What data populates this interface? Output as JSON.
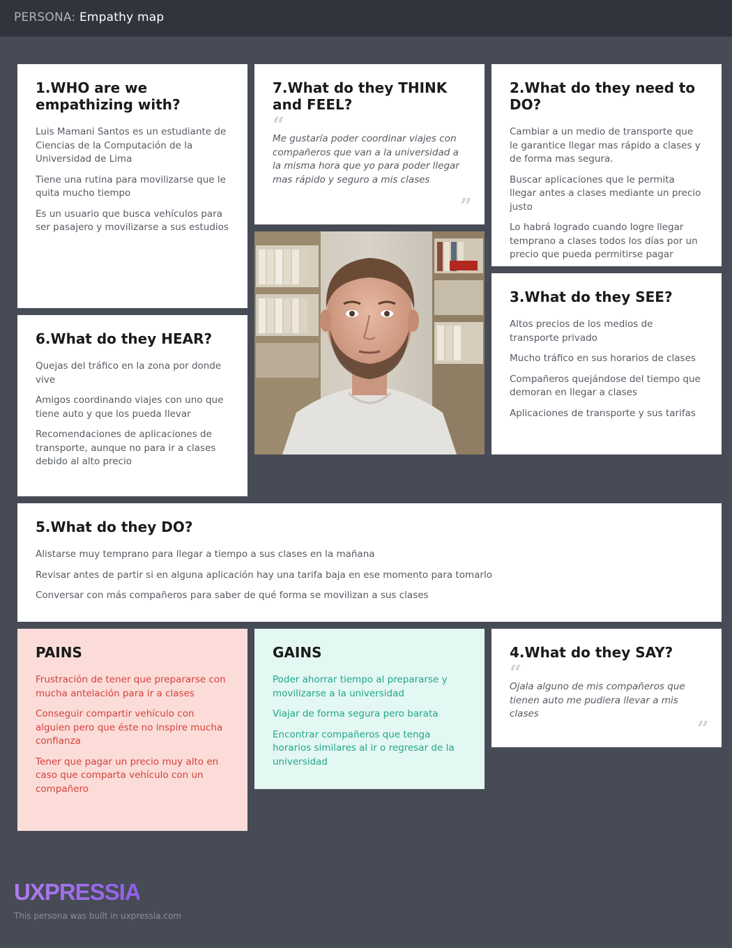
{
  "header": {
    "prefix": "PERSONA:",
    "title": "Empathy map"
  },
  "who": {
    "title": "1.WHO are we empathizing with?",
    "items": [
      "Luis Mamani Santos es un estudiante de Ciencias de la Computación de la Universidad de Lima",
      "Tiene una rutina para movilizarse que le quita mucho tiempo",
      "Es un usuario que busca vehículos para ser pasajero y movilizarse a sus estudios"
    ]
  },
  "think_feel": {
    "title": "7.What do they THINK and FEEL?",
    "quote": "Me gustaría poder coordinar viajes con compañeros que van a la universidad a la misma hora que yo para poder llegar mas rápido y seguro a mis clases"
  },
  "need_do": {
    "title": "2.What do they need to DO?",
    "items": [
      "Cambiar a un medio de transporte que le garantice llegar mas rápido a clases y de forma mas segura.",
      "Buscar aplicaciones que le permita llegar antes a clases mediante un precio justo",
      "Lo habrá logrado cuando logre llegar temprano a clases todos los días por un precio que pueda permitirse pagar"
    ]
  },
  "see": {
    "title": "3.What do they SEE?",
    "items": [
      "Altos precios de los medios de transporte privado",
      "Mucho tráfico en sus horarios de clases",
      "Compañeros quejándose del tiempo que demoran en llegar a clases",
      "Aplicaciones de transporte y sus tarifas"
    ]
  },
  "hear": {
    "title": "6.What do they HEAR?",
    "items": [
      "Quejas del tráfico en la zona por donde vive",
      "Amigos coordinando viajes con uno que tiene auto y que los pueda llevar",
      "Recomendaciones de aplicaciones de transporte, aunque no para ir a clases debido al alto precio"
    ]
  },
  "do": {
    "title": "5.What do they DO?",
    "items": [
      "Alistarse muy temprano para llegar a tiempo a sus clases en la mañana",
      "Revisar antes de partir si en alguna aplicación hay una tarifa baja en ese momento para tomarlo",
      "Conversar con más compañeros para saber de qué forma se movilizan a sus clases"
    ]
  },
  "pains": {
    "title": "PAINS",
    "items": [
      "Frustración de tener que prepararse con mucha antelación para ir a clases",
      "Conseguir compartir vehículo con alguien pero que éste no inspire mucha confianza",
      "Tener que pagar un precio muy alto en caso que comparta vehículo con un compañero"
    ]
  },
  "gains": {
    "title": "GAINS",
    "items": [
      "Poder ahorrar tiempo al prepararse y movilizarse a la universidad",
      "Viajar de forma segura pero barata",
      "Encontrar compañeros que tenga horarios similares al ir o regresar de la universidad"
    ]
  },
  "say": {
    "title": "4.What do they SAY?",
    "quote": "Ojala alguno de mis compañeros que tienen auto me pudiera llevar a mis clases"
  },
  "footer": {
    "logo": "UXPRESSIA",
    "note": "This persona was built in uxpressia.com"
  },
  "colors": {
    "background": "#474b55",
    "topbar": "#30343c",
    "pains_bg": "#fbdcd8",
    "pains_text": "#d4413a",
    "gains_bg": "#e3f7f3",
    "gains_text": "#21a68a",
    "logo_gradient_start": "#b07cf0",
    "logo_gradient_end": "#8e5fe6"
  }
}
